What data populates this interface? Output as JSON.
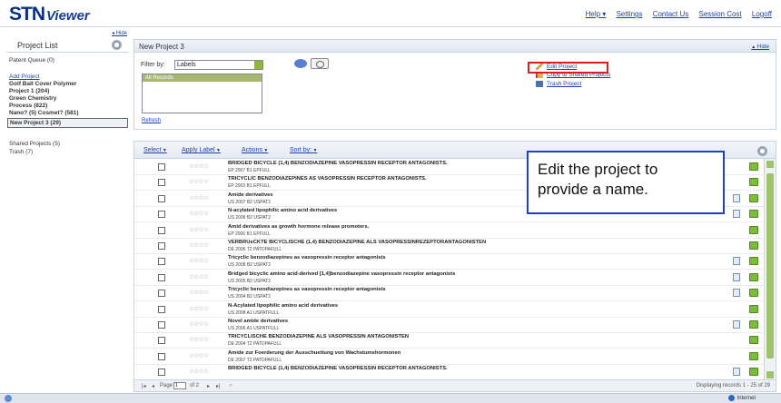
{
  "app": {
    "logo_main": "STN",
    "logo_sub": "Viewer"
  },
  "toplinks": [
    "Help ▾",
    "Settings",
    "Contact Us",
    "Session Cost",
    "Logoff"
  ],
  "left": {
    "hide": "◂ Hide",
    "title": "Project List",
    "items": [
      {
        "label": "Patent Queue (0)",
        "style": "plain"
      },
      {
        "label": "Add Project",
        "style": "link"
      },
      {
        "label": "Golf Ball Cover Polymer",
        "style": "bold"
      },
      {
        "label": "Project 1 (204)",
        "style": "bold"
      },
      {
        "label": "Green Chemistry",
        "style": "bold"
      },
      {
        "label": "Process (822)",
        "style": "bold"
      },
      {
        "label": "Nano? (5) Cosmet? (581)",
        "style": "bold"
      },
      {
        "label": "New Project 3 (29)",
        "style": "sel"
      },
      {
        "label": "Shared Projects (5)",
        "style": "plain"
      },
      {
        "label": "Trash (7)",
        "style": "plain"
      }
    ]
  },
  "project": {
    "title": "New Project 3",
    "hide": "Hide",
    "filter_label": "Filter by:",
    "filter_value": "Labels",
    "all_records": "All Records",
    "refresh": "Refresh",
    "actions": [
      "Edit Project",
      "Copy to Shared Projects",
      "Trash Project"
    ]
  },
  "toolbar": {
    "select": "Select",
    "apply": "Apply Label",
    "actions": "Actions",
    "sort": "Sort by:"
  },
  "records": [
    {
      "title": "BRIDGED BICYCLE (1,4) BENZODIAZEPINE VASOPRESSIN RECEPTOR ANTAGONISTS.",
      "sub": "EP 2007 B1 EPFULL",
      "doc": false
    },
    {
      "title": "TRICYCLIC BENZODIAZEPINES AS VASOPRESSIN RECEPTOR ANTAGONISTS.",
      "sub": "EP 2003 B1 EPFULL",
      "doc": false
    },
    {
      "title": "Amide derivatives",
      "sub": "US 2007 B2 USPAT2",
      "doc": true
    },
    {
      "title": "N-acylated lipophilic amino acid derivatives",
      "sub": "US 2006 B2 USPAT2",
      "doc": true
    },
    {
      "title": "Amid derivatives as growth hormone release promoters.",
      "sub": "EP 2006 B1 EPFULL",
      "doc": false
    },
    {
      "title": "VERBRUeCKTE BICYCLISCHE (1,4) BENZODIAZEPINE ALS VASOPRESSINREZEPTORANTAGONISTEN",
      "sub": "DE 2006 T2 PATDPAFULL",
      "doc": false
    },
    {
      "title": "Tricyclic benzodiazepines as vasopressin receptor antagonists",
      "sub": "US 2008 B2 USPAT2",
      "doc": true
    },
    {
      "title": "Bridged bicyclic amino acid-derived [1,4]benzodiazepine vasopressin receptor antagonists",
      "sub": "US 2005 B2 USPAT2",
      "doc": true
    },
    {
      "title": "Tricyclic benzodiazepines as vasopressin receptor antagonists",
      "sub": "US 2004 B2 USPAT2",
      "doc": true
    },
    {
      "title": "N-Acylated lipophilic amino acid derivatives",
      "sub": "US 2008 A1 USPATFULL",
      "doc": false
    },
    {
      "title": "Novel amide derivatives",
      "sub": "US 2006 A1 USPATFULL",
      "doc": true
    },
    {
      "title": "TRICYCLISCHE BENZODIAZEPINE ALS VASOPRESSIN ANTAGONISTEN",
      "sub": "DE 2004 T2 PATDPAFULL",
      "doc": false
    },
    {
      "title": "Amide zur Foerderung der Ausschuettung von Wachstumshormonen",
      "sub": "DE 2007 T2 PATDPAFULL",
      "doc": false
    },
    {
      "title": "BRIDGED BICYCLE (1,4) BENZODIAZEPINE VASOPRESSIN RECEPTOR ANTAGONISTS.",
      "sub": "",
      "doc": true
    }
  ],
  "pager": {
    "page_label": "Page",
    "page": "1",
    "of": "of 2",
    "info": "Displaying records 1 - 25 of 29"
  },
  "callout": [
    "Edit the project to",
    "provide a name."
  ],
  "status": {
    "zone": "Internet"
  },
  "colors": {
    "link": "#1f3fa8",
    "highlight": "#e11b1b",
    "callout_border": "#1b3fd0",
    "accent_green": "#7dbb3a"
  }
}
